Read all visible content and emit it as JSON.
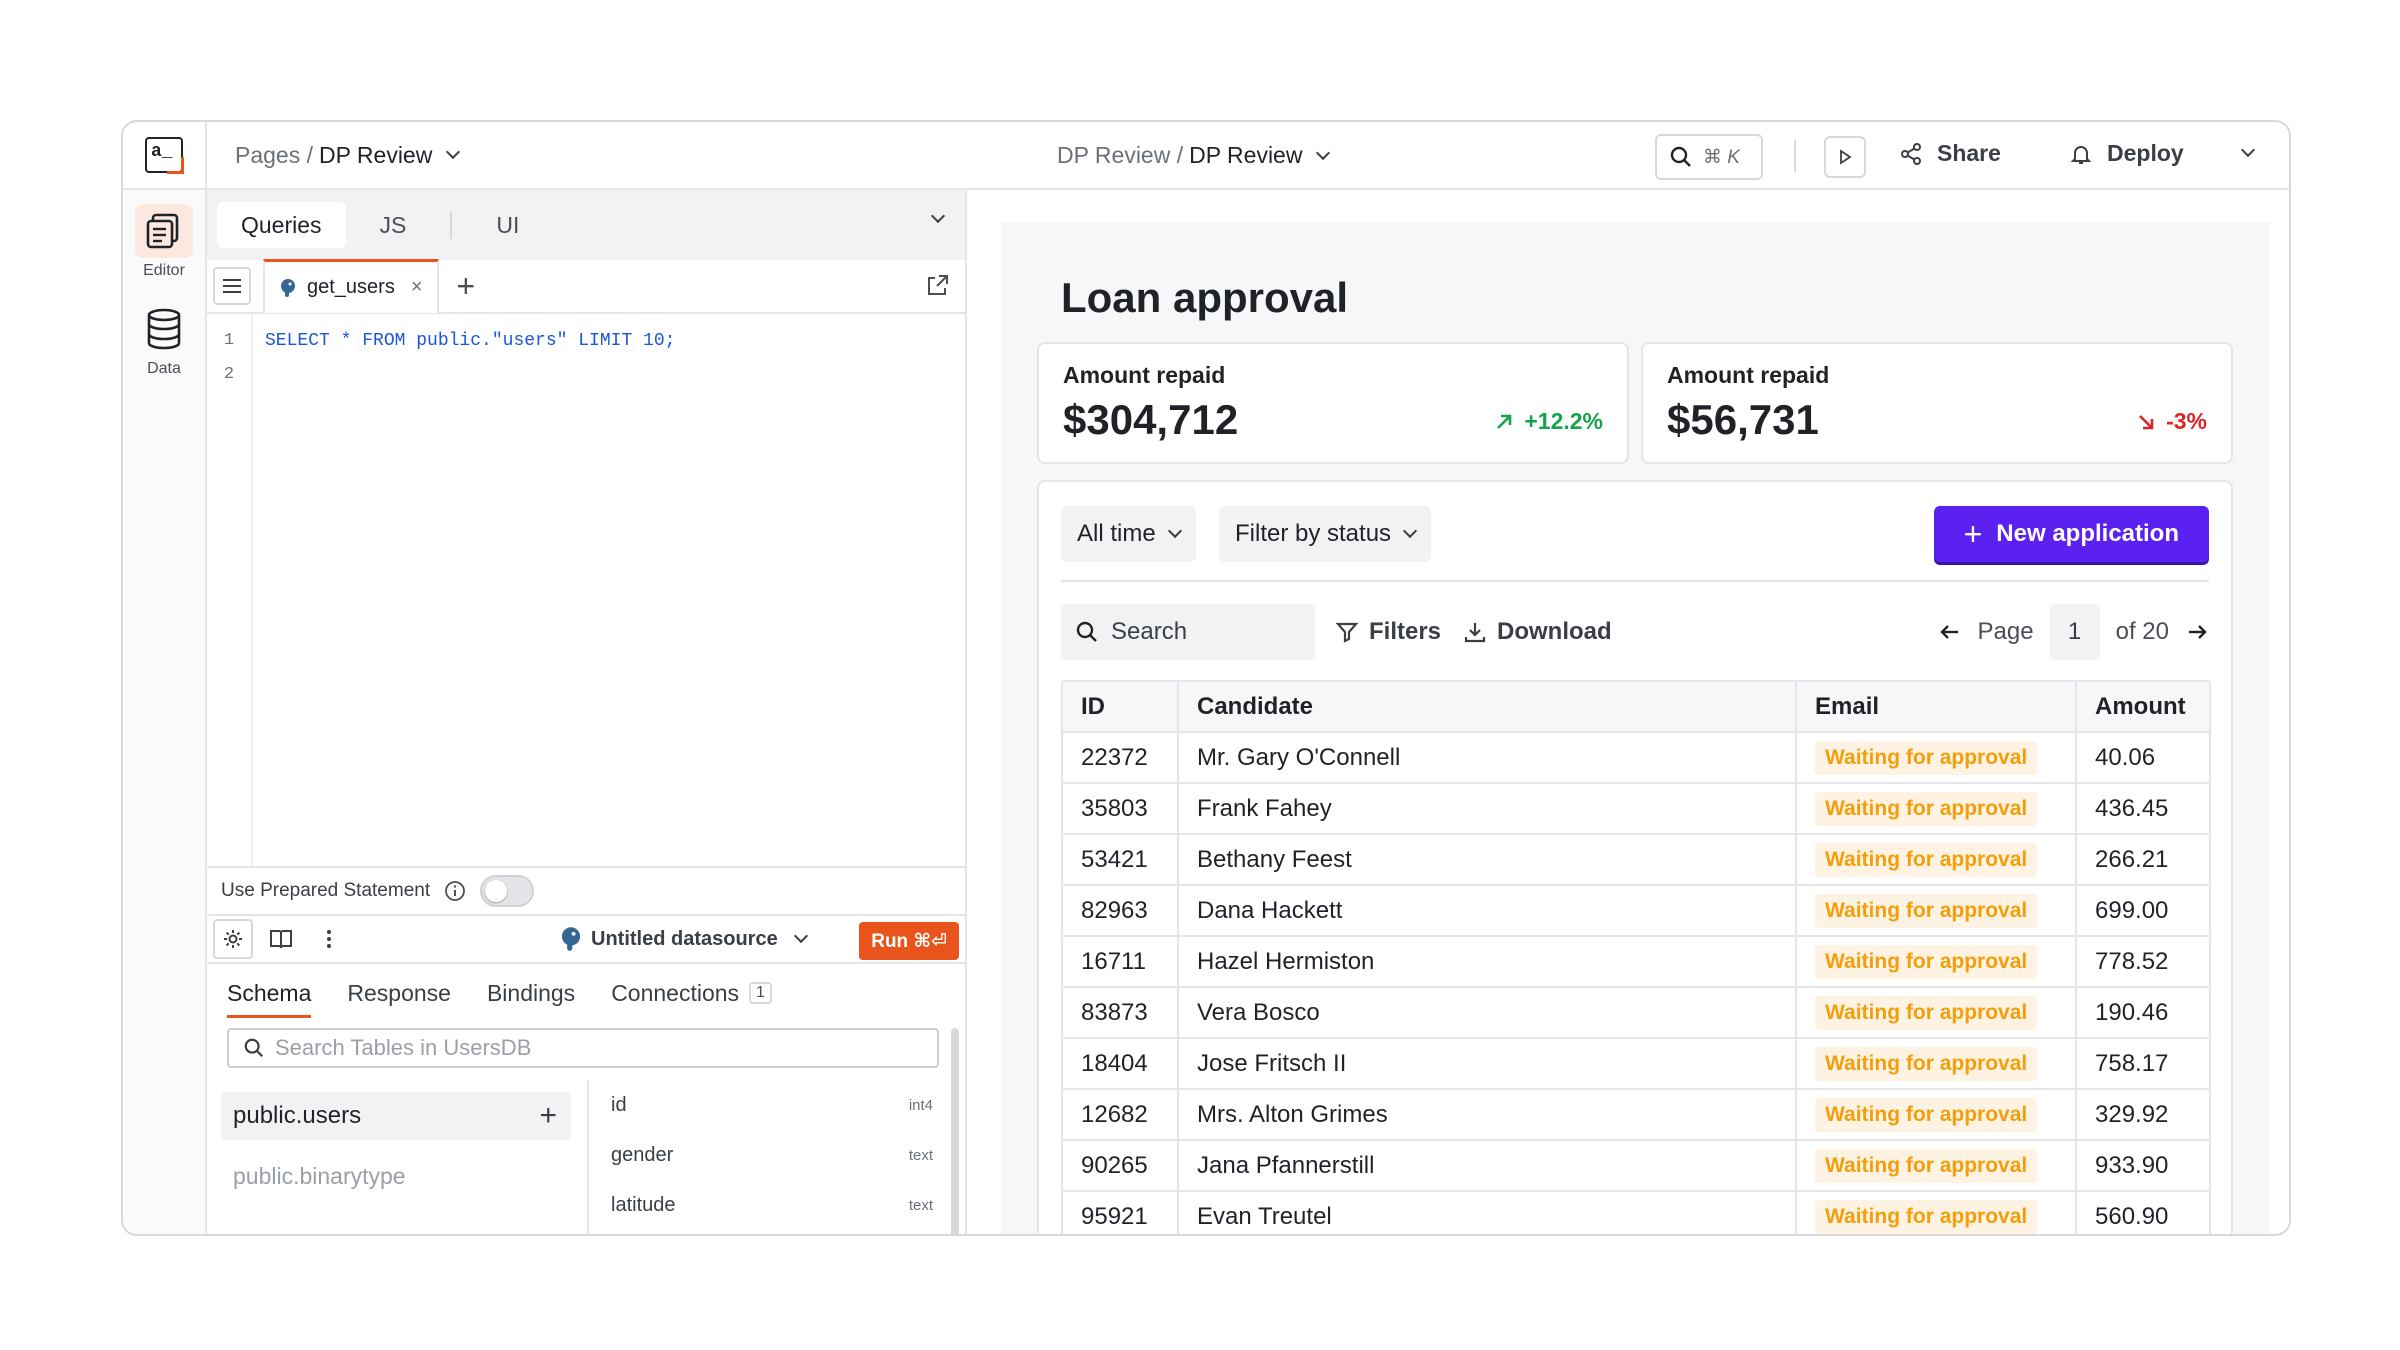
{
  "topbar": {
    "logo_text": "a_",
    "crumb_pages": "Pages /",
    "crumb_page": "DP Review",
    "center_app": "DP Review /",
    "center_page": "DP Review",
    "shortcut": "⌘ K",
    "share": "Share",
    "deploy": "Deploy"
  },
  "rail": {
    "editor": "Editor",
    "data": "Data"
  },
  "editor": {
    "tabs": [
      "Queries",
      "JS",
      "UI"
    ],
    "query_tab": "get_users",
    "line_numbers": [
      "1",
      "2"
    ],
    "code": "SELECT * FROM public.\"users\" LIMIT 10;",
    "prepared_label": "Use Prepared Statement",
    "datasource": "Untitled datasource",
    "run_label": "Run ⌘⏎",
    "result_tabs": [
      "Schema",
      "Response",
      "Bindings",
      "Connections"
    ],
    "connections_count": "1",
    "search_placeholder": "Search Tables in UsersDB",
    "tables": [
      "public.users",
      "public.binarytype"
    ],
    "columns": [
      {
        "name": "id",
        "type": "int4"
      },
      {
        "name": "gender",
        "type": "text"
      },
      {
        "name": "latitude",
        "type": "text"
      }
    ]
  },
  "app": {
    "title": "Loan approval",
    "stats": [
      {
        "label": "Amount repaid",
        "value": "$304,712",
        "change": "+12.2%",
        "color": "#16a34a"
      },
      {
        "label": "Amount repaid",
        "value": "$56,731",
        "change": "-3%",
        "color": "#dc2626"
      }
    ],
    "filter_time": "All time",
    "filter_status": "Filter by status",
    "new_application": "New application",
    "search": "Search",
    "filters": "Filters",
    "download": "Download",
    "page_label": "Page",
    "page_num": "1",
    "page_of": "of 20",
    "columns": [
      "ID",
      "Candidate",
      "Email",
      "Amount"
    ],
    "rows": [
      {
        "id": "22372",
        "name": "Mr. Gary O'Connell",
        "status": "Waiting for approval",
        "amount": "40.06"
      },
      {
        "id": "35803",
        "name": "Frank Fahey",
        "status": "Waiting for approval",
        "amount": "436.45"
      },
      {
        "id": "53421",
        "name": "Bethany Feest",
        "status": "Waiting for approval",
        "amount": "266.21"
      },
      {
        "id": "82963",
        "name": "Dana Hackett",
        "status": "Waiting for approval",
        "amount": "699.00"
      },
      {
        "id": "16711",
        "name": "Hazel Hermiston",
        "status": "Waiting for approval",
        "amount": "778.52"
      },
      {
        "id": "83873",
        "name": "Vera Bosco",
        "status": "Waiting for approval",
        "amount": "190.46"
      },
      {
        "id": "18404",
        "name": "Jose Fritsch II",
        "status": "Waiting for approval",
        "amount": "758.17"
      },
      {
        "id": "12682",
        "name": "Mrs. Alton Grimes",
        "status": "Waiting for approval",
        "amount": "329.92"
      },
      {
        "id": "90265",
        "name": "Jana Pfannerstill",
        "status": "Waiting for approval",
        "amount": "933.90"
      },
      {
        "id": "95921",
        "name": "Evan Treutel",
        "status": "Waiting for approval",
        "amount": "560.90"
      }
    ]
  },
  "colors": {
    "accent": "#e8541c",
    "primary": "#5b21f0",
    "pending": "#f59e0b"
  }
}
